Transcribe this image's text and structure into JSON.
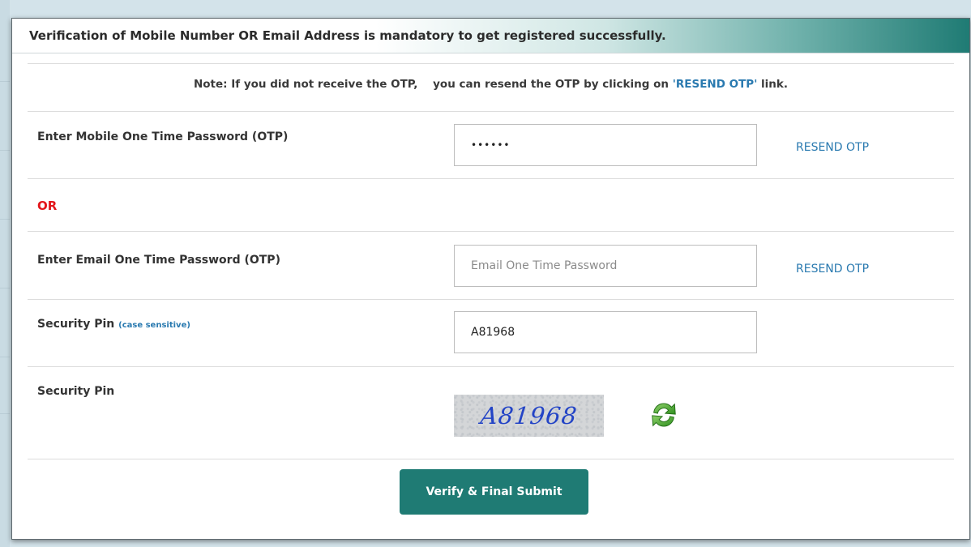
{
  "modal": {
    "title": "Verification of Mobile Number OR Email Address is mandatory to get registered successfully."
  },
  "note": {
    "prefix": "Note: If you did not receive the OTP,    you can resend the OTP by clicking on ",
    "link": "'RESEND OTP'",
    "suffix": " link."
  },
  "mobile_otp": {
    "label": "Enter Mobile One Time Password (OTP)",
    "value": "••••••",
    "resend_label": "RESEND OTP"
  },
  "or_label": "OR",
  "email_otp": {
    "label": "Enter Email One Time Password (OTP)",
    "placeholder": "Email One Time Password",
    "value": "",
    "resend_label": "RESEND OTP"
  },
  "security_pin_input": {
    "label": "Security Pin",
    "hint": "(case sensitive)",
    "value": "A81968"
  },
  "security_pin_captcha": {
    "label": "Security Pin",
    "captcha_text": "A81968",
    "refresh_icon": "refresh-icon"
  },
  "submit_label": "Verify & Final Submit",
  "colors": {
    "primary": "#1f7b74",
    "link": "#2a7ab0",
    "or": "#e3161b",
    "captcha_text": "#2344c6"
  }
}
